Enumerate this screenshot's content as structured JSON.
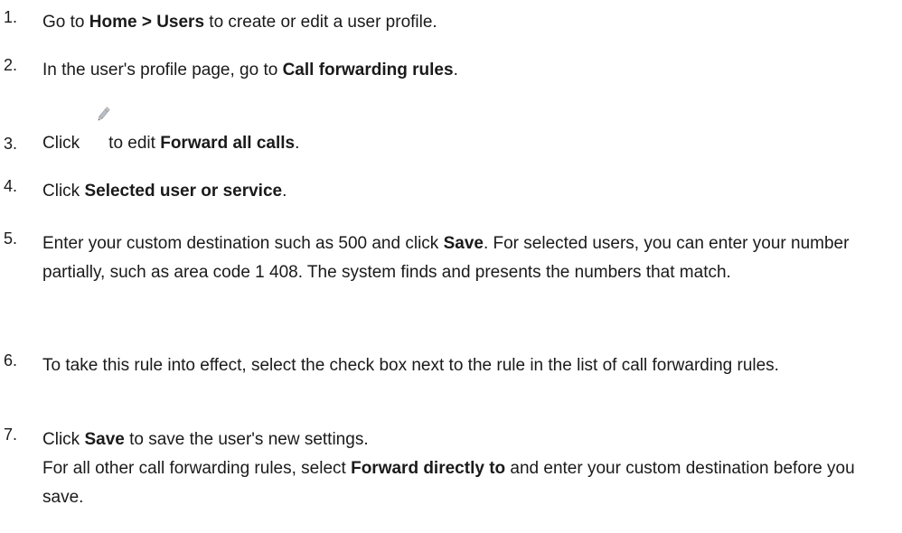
{
  "steps": [
    {
      "number": "1.",
      "parts": [
        "Go to ",
        "Home > Users",
        " to create or edit a user profile."
      ]
    },
    {
      "number": "2.",
      "parts": [
        "In the user's profile page, go to ",
        "Call forwarding rules",
        "."
      ]
    },
    {
      "number": "3.",
      "icon": "pencil-edit-icon",
      "parts": [
        "Click",
        "to edit ",
        "Forward all calls",
        "."
      ]
    },
    {
      "number": "4.",
      "parts": [
        "Click ",
        "Selected user or service",
        "."
      ]
    },
    {
      "number": "5.",
      "parts": [
        "Enter your custom destination such as 500 and click ",
        "Save",
        ". For selected users, you can enter your number partially, such as area code 1 408. The system finds and presents the numbers that match."
      ]
    },
    {
      "number": "6.",
      "parts": [
        "To take this rule into effect, select the check box next to the rule in the list of call forwarding rules."
      ]
    },
    {
      "number": "7.",
      "parts": [
        "Click ",
        "Save",
        " to save the user's new settings."
      ],
      "note_parts": [
        "For all other call forwarding rules, select ",
        "Forward directly to",
        " and enter your custom destination before you save."
      ]
    }
  ]
}
